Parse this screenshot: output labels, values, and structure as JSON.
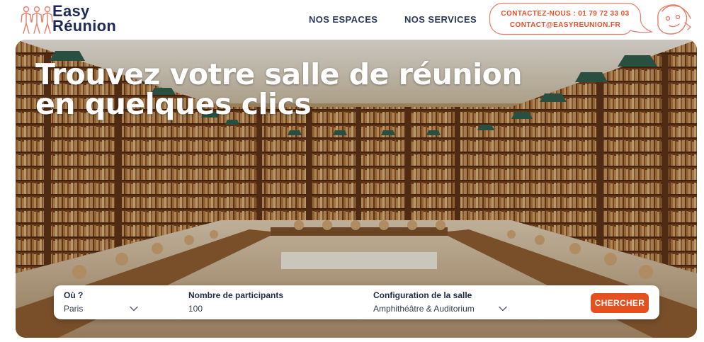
{
  "brand": {
    "line1": "Easy",
    "line2": "Réunion"
  },
  "nav": {
    "espaces": "NOS ESPACES",
    "services": "NOS SERVICES"
  },
  "contact": {
    "phone": "CONTACTEZ-NOUS : 01 79 72 33 03",
    "email": "CONTACT@EASYREUNION.FR"
  },
  "hero": {
    "title_line1": "Trouvez votre salle de réunion",
    "title_line2": "en quelques clics"
  },
  "search": {
    "where": {
      "label": "Où ?",
      "value": "Paris"
    },
    "participants": {
      "label": "Nombre de participants",
      "value": "100"
    },
    "configuration": {
      "label": "Configuration de la salle",
      "value": "Amphithéâtre & Auditorium"
    },
    "button": "CHERCHER"
  },
  "colors": {
    "accent": "#e4501f",
    "navy": "#1f2a5a",
    "logo_people": "#e8806a"
  },
  "icons": [
    "logo-people-icon",
    "mascot-icon",
    "chevron-down-icon"
  ]
}
